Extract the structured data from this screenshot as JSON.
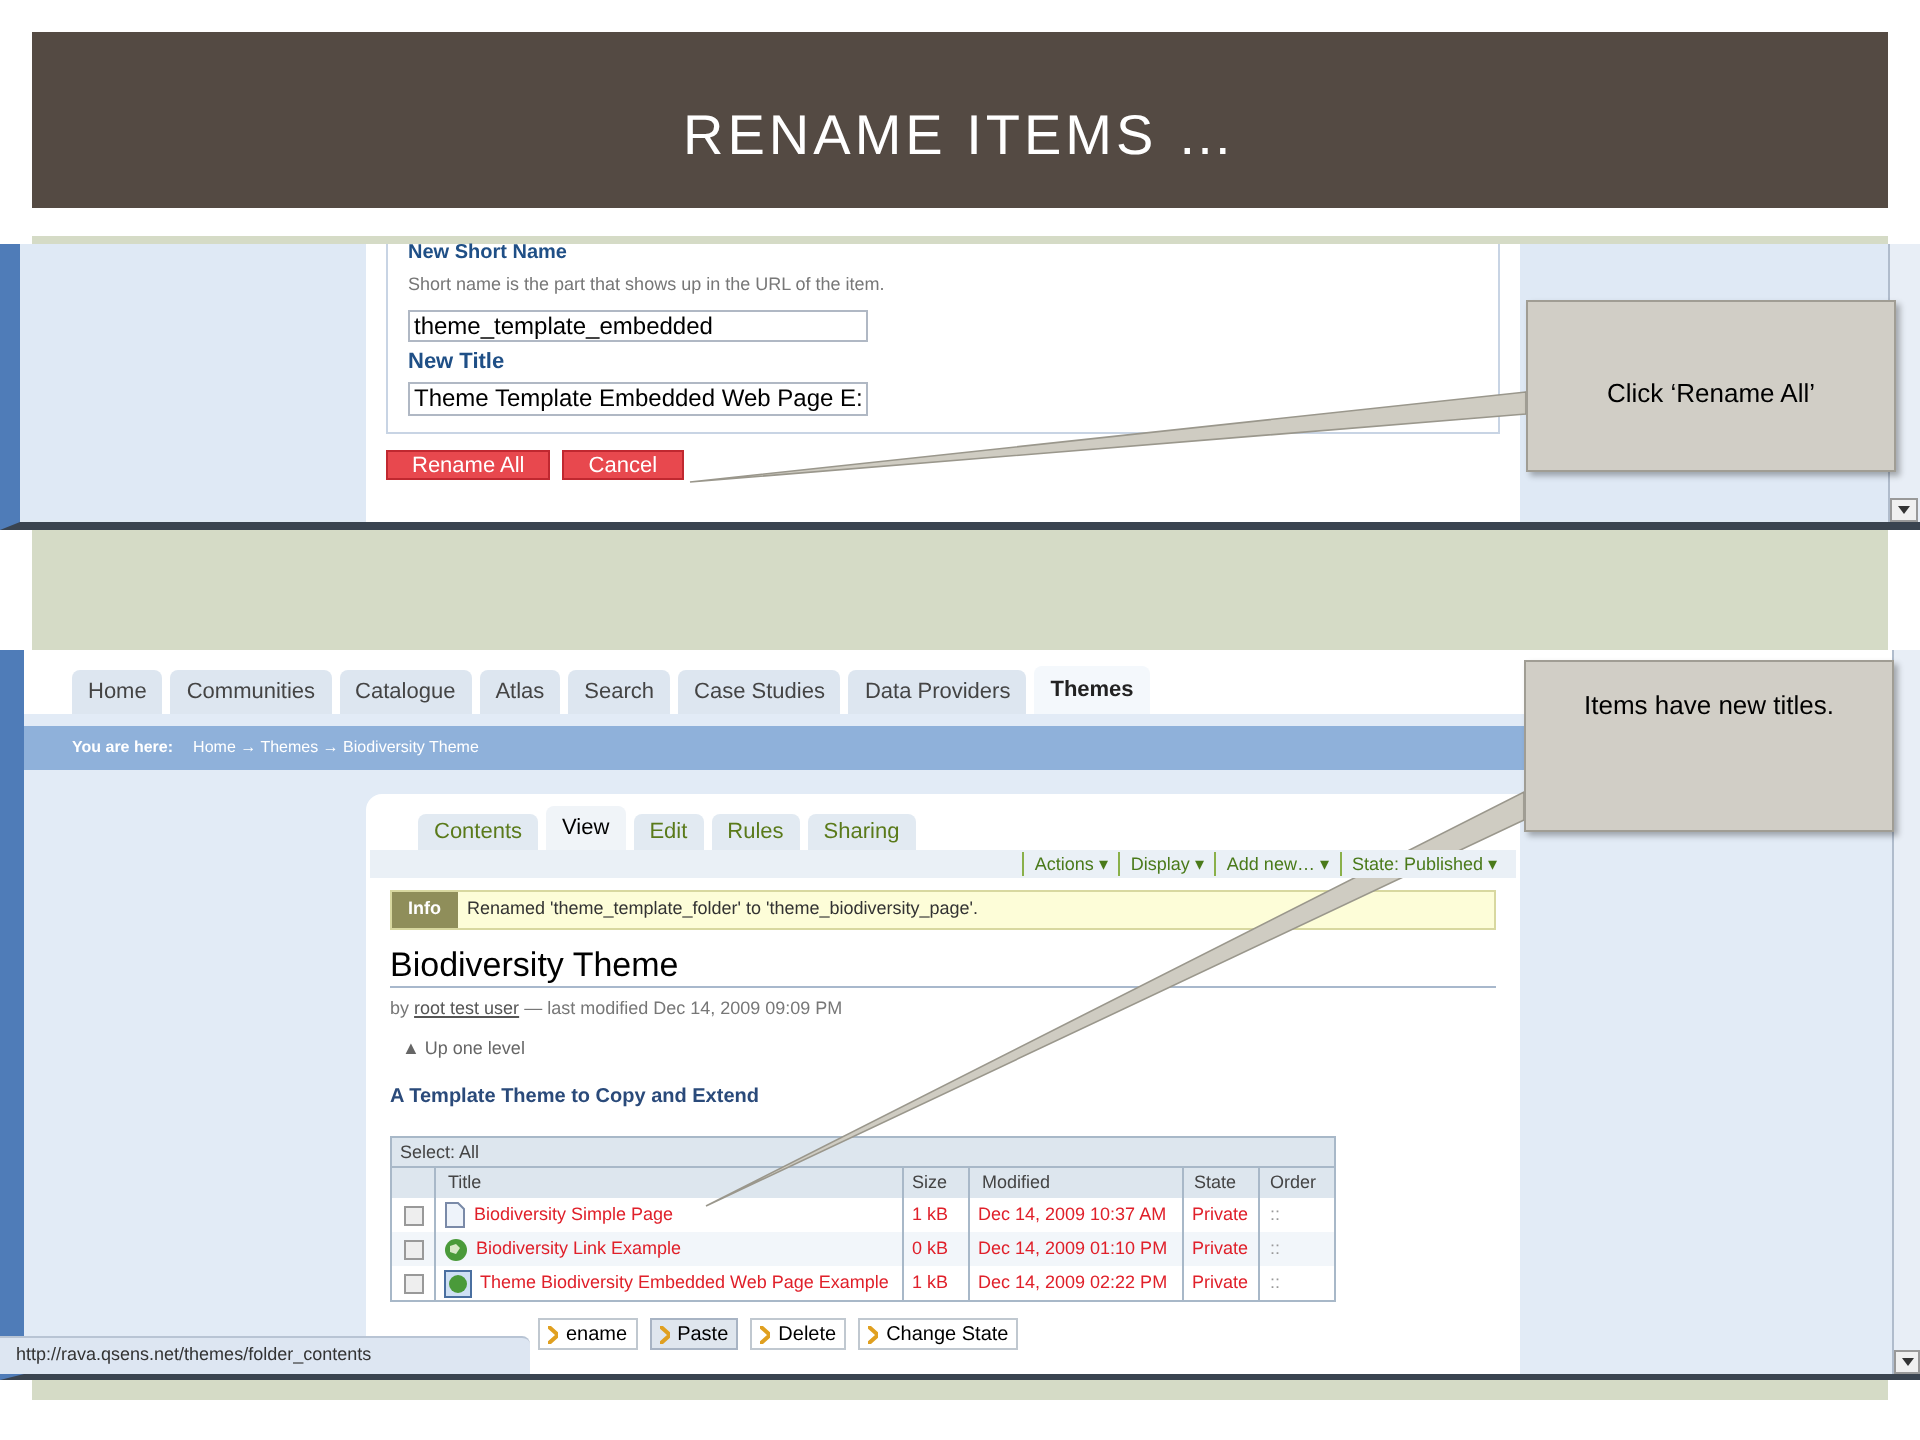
{
  "slide_title": "RENAME ITEMS …",
  "rename_form": {
    "short_name_label": "New Short Name",
    "short_name_hint": "Short name is the part that shows up in the URL of the item.",
    "short_name_value": "theme_template_embedded",
    "title_label": "New Title",
    "title_value": "Theme Template Embedded Web Page E:",
    "buttons": [
      "Rename All",
      "Cancel"
    ]
  },
  "callouts": [
    {
      "text": "Click ‘Rename All’"
    },
    {
      "text": "Items have new titles."
    }
  ],
  "site": {
    "tabs": [
      {
        "label": "Home",
        "selected": false
      },
      {
        "label": "Communities",
        "selected": false
      },
      {
        "label": "Catalogue",
        "selected": false
      },
      {
        "label": "Atlas",
        "selected": false
      },
      {
        "label": "Search",
        "selected": false
      },
      {
        "label": "Case Studies",
        "selected": false
      },
      {
        "label": "Data Providers",
        "selected": false
      },
      {
        "label": "Themes",
        "selected": true
      }
    ],
    "breadcrumb": {
      "label": "You are here:",
      "path": "Home → Themes → Biodiversity Theme"
    },
    "content_tabs": [
      {
        "label": "Contents",
        "selected": false
      },
      {
        "label": "View",
        "selected": true
      },
      {
        "label": "Edit",
        "selected": false
      },
      {
        "label": "Rules",
        "selected": false
      },
      {
        "label": "Sharing",
        "selected": false
      }
    ],
    "actions": [
      "Actions ▾",
      "Display ▾",
      "Add new… ▾",
      "State: Published ▾"
    ],
    "info": {
      "badge": "Info",
      "message": "Renamed 'theme_template_folder' to 'theme_biodiversity_page'."
    },
    "heading": "Biodiversity Theme",
    "byline": {
      "prefix": "by",
      "author": "root test user",
      "suffix": "— last modified Dec 14, 2009 09:09 PM"
    },
    "up_link": "▲ Up one level",
    "description": "A Template Theme to Copy and Extend",
    "table": {
      "select_label": "Select: All",
      "columns": [
        "Title",
        "Size",
        "Modified",
        "State",
        "Order"
      ],
      "rows": [
        {
          "checked": false,
          "kind": "page",
          "title": "Biodiversity Simple Page",
          "size": "1 kB",
          "modified": "Dec 14, 2009 10:37 AM",
          "state": "Private",
          "order": "::"
        },
        {
          "checked": false,
          "kind": "link",
          "title": "Biodiversity Link Example",
          "size": "0 kB",
          "modified": "Dec 14, 2009 01:10 PM",
          "state": "Private",
          "order": "::"
        },
        {
          "checked": false,
          "kind": "embedded",
          "title": "Theme Biodiversity Embedded Web Page Example",
          "size": "1 kB",
          "modified": "Dec 14, 2009 02:22 PM",
          "state": "Private",
          "order": "::"
        }
      ]
    },
    "buttons": [
      {
        "label": "ename",
        "selected": false
      },
      {
        "label": "Paste",
        "selected": true
      },
      {
        "label": "Delete",
        "selected": false
      },
      {
        "label": "Change State",
        "selected": false
      }
    ]
  },
  "status_bar": "http://rava.qsens.net/themes/folder_contents"
}
